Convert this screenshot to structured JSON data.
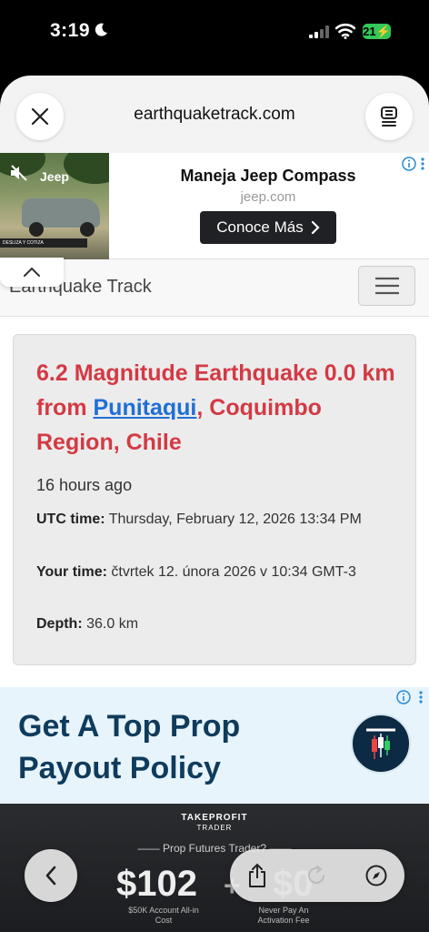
{
  "status_bar": {
    "time": "3:19",
    "battery": "21"
  },
  "browser": {
    "url": "earthquaketrack.com"
  },
  "ad_top": {
    "title": "Maneja Jeep Compass",
    "domain": "jeep.com",
    "cta": "Conoce Más",
    "image_brand": "Jeep",
    "image_strip": "DESLIZA Y COTIZA"
  },
  "site": {
    "brand": "Earthquake Track"
  },
  "quake": {
    "title_part1": "6.2 Magnitude Earthquake 0.0 km from ",
    "place_link": "Punitaqui",
    "title_part2": ", Coquimbo Region, Chile",
    "ago": "16 hours ago",
    "utc_label": "UTC time:",
    "utc_value": " Thursday, February 12, 2026 13:34 PM",
    "local_label": "Your time:",
    "local_value": " čtvrtek 12. února 2026 v 10:34 GMT-3",
    "depth_label": "Depth:",
    "depth_value": " 36.0 km"
  },
  "ad_bottom": {
    "headline": "Get A Top Prop Payout Policy",
    "brand_line1": "TAKEPROFIT",
    "brand_line2": "TRADER",
    "subhead": "Prop Futures Trader?",
    "big1": "$102",
    "plus": "+",
    "big2": "$0",
    "caption1": "$50K Account All-in Cost",
    "caption2": "Never Pay An Activation Fee"
  },
  "icons": {
    "close": "close-icon",
    "reader": "reader-icon",
    "back": "chevron-left-icon",
    "share": "share-icon",
    "reload": "reload-icon",
    "compass": "compass-icon"
  },
  "colors": {
    "quake_title": "#d33a44",
    "link": "#1f6fd6",
    "ad_headline": "#0f3b5c",
    "battery": "#34c759"
  }
}
